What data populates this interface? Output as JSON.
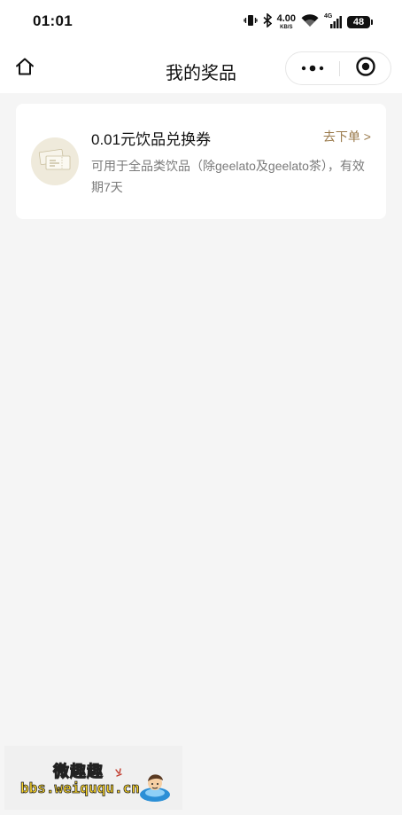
{
  "status_bar": {
    "time": "01:01",
    "net_speed_value": "4.00",
    "net_speed_unit": "KB/S",
    "network_type": "4G",
    "battery_level": "48",
    "icons": [
      "vibrate-icon",
      "bluetooth-icon",
      "wifi-icon",
      "cellular-signal-icon",
      "battery-icon"
    ]
  },
  "nav": {
    "title": "我的奖品",
    "home_icon": "home-icon",
    "more_icon": "more-dots-icon",
    "close_icon": "target-close-icon"
  },
  "prizes": [
    {
      "name": "0.01元饮品兑换券",
      "action": "去下单 >",
      "description": "可用于全品类饮品（除geelato及geelato茶），有效期7天",
      "thumb_icon": "coupon-tickets-icon"
    }
  ],
  "watermark": {
    "title": "微趣趣",
    "url": "bbs.weiququ.cn"
  },
  "colors": {
    "page_background": "#f5f5f5",
    "card_background": "#ffffff",
    "accent_gold": "#9a7a4b",
    "secondary_text": "#7a7a7a"
  }
}
